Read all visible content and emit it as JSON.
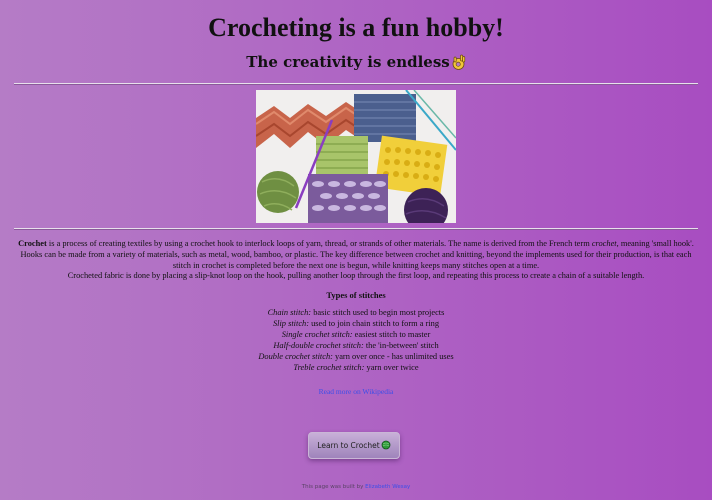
{
  "header": {
    "title": "Crocheting is a fun hobby!",
    "subtitle": "The creativity is endless",
    "subtitle_icon": "ok-hand-emoji-icon"
  },
  "hero_image": {
    "alt": "crochet swatches and yarn balls"
  },
  "intro": {
    "term": "Crochet",
    "text_part1": " is a process of creating textiles by using a crochet hook to interlock loops of yarn, thread, or strands of other materials. The name is derived from the French term ",
    "text_italic": "crochet",
    "text_part2": ", meaning 'small hook'. Hooks can be made from a variety of materials, such as metal, wood, bamboo, or plastic. The key difference between crochet and knitting, beyond the implements used for their production, is that each stitch in crochet is completed before the next one is begun, while knitting keeps many stitches open at a time.",
    "text_part3": "Crocheted fabric is done by placing a slip-knot loop on the hook, pulling another loop through the first loop, and repeating this process to create a chain of a suitable length."
  },
  "stitches": {
    "title": "Types of stitches",
    "items": [
      {
        "name": "Chain stitch:",
        "desc": " basic stitch used to begin most projects"
      },
      {
        "name": "Slip stitch:",
        "desc": " used to join chain stitch to form a ring"
      },
      {
        "name": "Single crochet stitch:",
        "desc": " easiest stitch to master"
      },
      {
        "name": "Half-double crochet stitch:",
        "desc": " the 'in-between' stitch"
      },
      {
        "name": "Double crochet stitch:",
        "desc": " yarn over once - has unlimited uses"
      },
      {
        "name": "Treble crochet stitch:",
        "desc": " yarn over twice"
      }
    ]
  },
  "wiki_link": {
    "label": "Read more on Wikipedia"
  },
  "learn_button": {
    "label": "Learn to Crochet",
    "icon": "yarn-ball-icon"
  },
  "footer": {
    "prefix": "This page was built by ",
    "author": "Elizabeth Wesay"
  },
  "colors": {
    "background_left": "#b57cc6",
    "background_right": "#a84dc1",
    "link": "#3c4ee8"
  }
}
